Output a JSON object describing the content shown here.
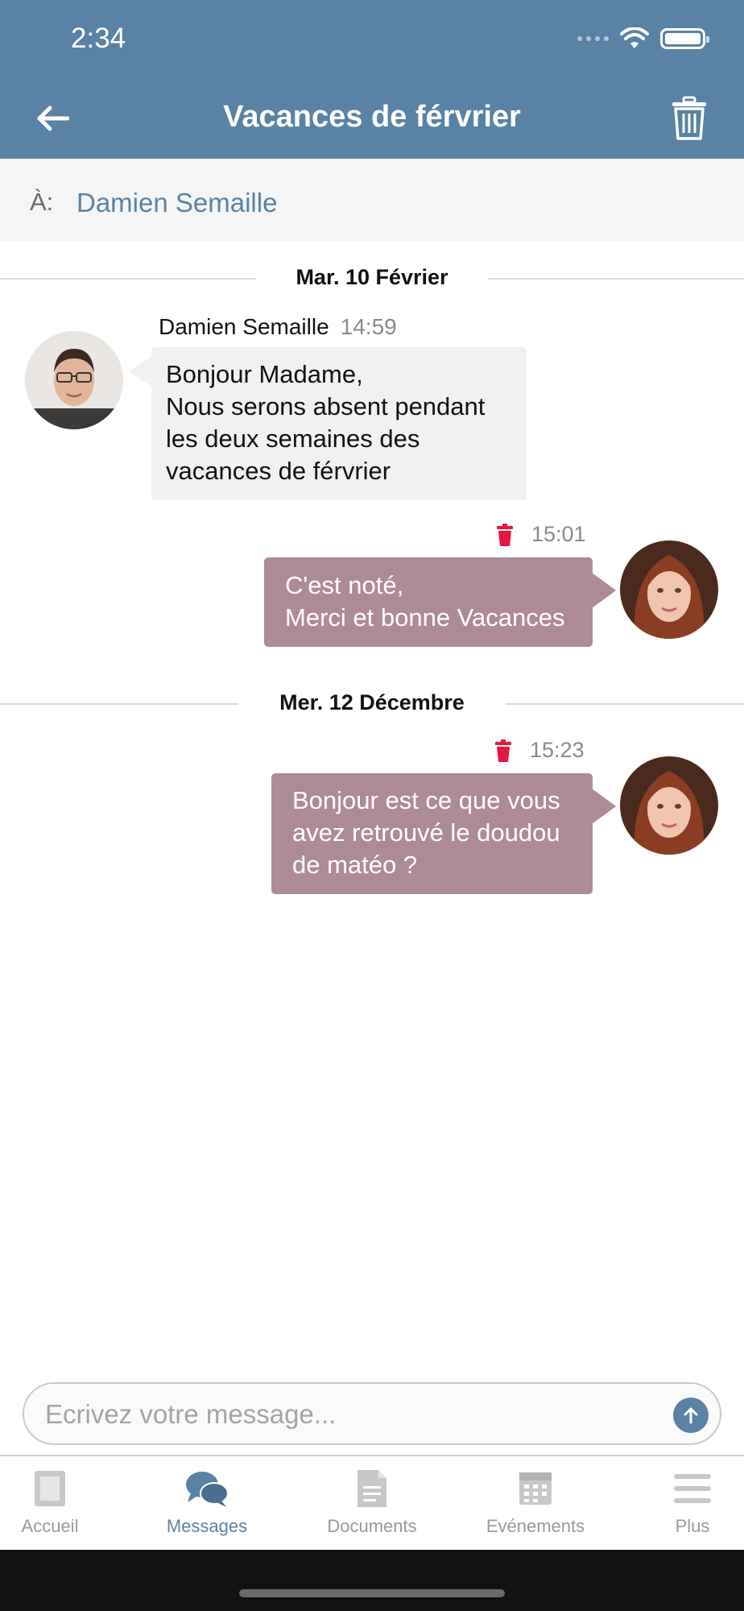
{
  "status_bar": {
    "time": "2:34"
  },
  "header": {
    "title": "Vacances de férvrier"
  },
  "recipient": {
    "label": "À:",
    "name": "Damien Semaille"
  },
  "dates": [
    "Mar. 10 Février",
    "Mer. 12 Décembre"
  ],
  "messages": [
    {
      "direction": "incoming",
      "sender": "Damien Semaille",
      "time": "14:59",
      "lines": [
        "Bonjour Madame,",
        "Nous serons absent pendant",
        "les deux semaines des",
        "vacances de férvrier"
      ]
    },
    {
      "direction": "outgoing",
      "time": "15:01",
      "lines": [
        "C'est noté,",
        "Merci et bonne Vacances"
      ]
    },
    {
      "direction": "outgoing",
      "time": "15:23",
      "lines": [
        "Bonjour est ce que vous",
        "avez retrouvé le doudou",
        "de matéo ?"
      ]
    }
  ],
  "composer": {
    "placeholder": "Ecrivez votre message..."
  },
  "tabs": [
    {
      "label": "Accueil",
      "icon": "home-icon",
      "active": false
    },
    {
      "label": "Messages",
      "icon": "chat-icon",
      "active": true
    },
    {
      "label": "Documents",
      "icon": "document-icon",
      "active": false
    },
    {
      "label": "Evénements",
      "icon": "calendar-icon",
      "active": false
    },
    {
      "label": "Plus",
      "icon": "menu-icon",
      "active": false
    }
  ],
  "colors": {
    "header": "#5a82a5",
    "outgoing_bubble": "#ad8a98",
    "incoming_bubble": "#f1f1f1",
    "delete_icon": "#e8173f",
    "accent": "#5a82a5"
  }
}
